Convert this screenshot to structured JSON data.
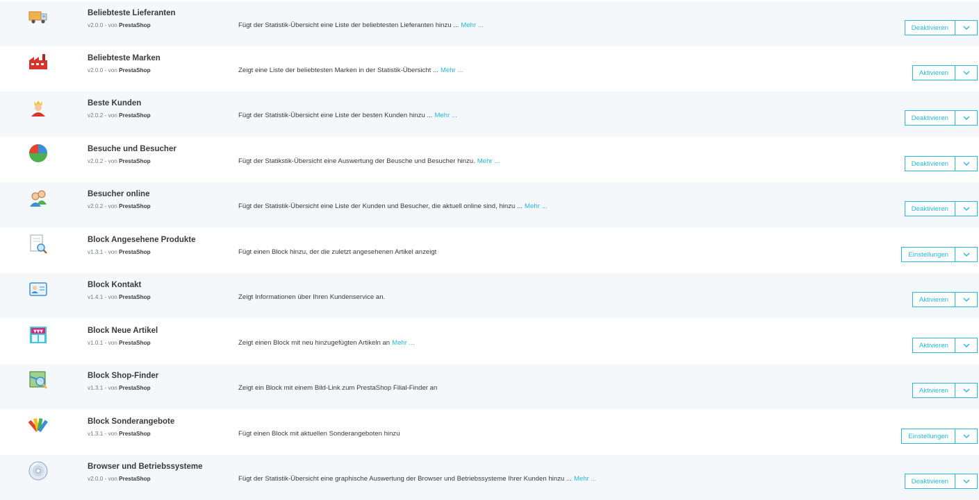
{
  "colors": {
    "accent": "#25b9d7",
    "row_alt_bg": "#f4f8fb",
    "text": "#363a41"
  },
  "modules": [
    {
      "name": "Beliebteste Lieferanten",
      "version": "v2.0.0",
      "by": "- von",
      "author": "PrestaShop",
      "description": "Fügt der Statistik-Übersicht eine Liste der beliebtesten Lieferanten hinzu ...",
      "more": "Mehr ...",
      "action": "Deaktivieren",
      "icon": "truck-icon"
    },
    {
      "name": "Beliebteste Marken",
      "version": "v2.0.0",
      "by": "- von",
      "author": "PrestaShop",
      "description": "Zeigt eine Liste der beliebtesten Marken in der Statistik-Übersicht ...",
      "more": "Mehr ...",
      "action": "Aktivieren",
      "icon": "factory-icon"
    },
    {
      "name": "Beste Kunden",
      "version": "v2.0.2",
      "by": "- von",
      "author": "PrestaShop",
      "description": "Fügt der Statistik-Übersicht eine Liste der besten Kunden hinzu ...",
      "more": "Mehr ...",
      "action": "Deaktivieren",
      "icon": "king-icon"
    },
    {
      "name": "Besuche und Besucher",
      "version": "v2.0.2",
      "by": "- von",
      "author": "PrestaShop",
      "description": "Fügt der Statikstik-Übersicht eine Auswertung der Beusche und Besucher hinzu.",
      "more": "Mehr ...",
      "action": "Deaktivieren",
      "icon": "pie-chart-icon"
    },
    {
      "name": "Besucher online",
      "version": "v2.0.2",
      "by": "- von",
      "author": "PrestaShop",
      "description": "Fügt der Statistik-Übersicht eine Liste der Kunden und Besucher, die aktuell online sind, hinzu ...",
      "more": "Mehr ...",
      "action": "Deaktivieren",
      "icon": "users-icon"
    },
    {
      "name": "Block Angesehene Produkte",
      "version": "v1.3.1",
      "by": "- von",
      "author": "PrestaShop",
      "description": "Fügt einen Block hinzu, der die zuletzt angesehenen Artikel anzeigt",
      "more": "",
      "action": "Einstellungen",
      "icon": "document-search-icon"
    },
    {
      "name": "Block Kontakt",
      "version": "v1.4.1",
      "by": "- von",
      "author": "PrestaShop",
      "description": "Zeigt Informationen über Ihren Kundenservice an.",
      "more": "",
      "action": "Aktivieren",
      "icon": "contact-card-icon"
    },
    {
      "name": "Block Neue Artikel",
      "version": "v1.0.1",
      "by": "- von",
      "author": "PrestaShop",
      "description": "Zeigt einen Block mit neu hinzugefügten Artikeln an",
      "more": "Mehr ...",
      "action": "Aktivieren",
      "icon": "new-products-icon"
    },
    {
      "name": "Block Shop-Finder",
      "version": "v1.3.1",
      "by": "- von",
      "author": "PrestaShop",
      "description": "Zeigt ein Block mit einem Bild-Link zum PrestaShop Filial-Finder an",
      "more": "",
      "action": "Aktivieren",
      "icon": "map-search-icon"
    },
    {
      "name": "Block Sonderangebote",
      "version": "v1.3.1",
      "by": "- von",
      "author": "PrestaShop",
      "description": "Fügt einen Block mit aktuellen Sonderangeboten hinzu",
      "more": "",
      "action": "Einstellungen",
      "icon": "color-swatches-icon"
    },
    {
      "name": "Browser und Betriebssysteme",
      "version": "v2.0.0",
      "by": "- von",
      "author": "PrestaShop",
      "description": "Fügt der Statistik-Übersicht eine graphische Auswertung der Browser und Betriebssysteme Ihrer Kunden hinzu ...",
      "more": "Mehr ...",
      "action": "Deaktivieren",
      "icon": "cd-disc-icon"
    }
  ]
}
